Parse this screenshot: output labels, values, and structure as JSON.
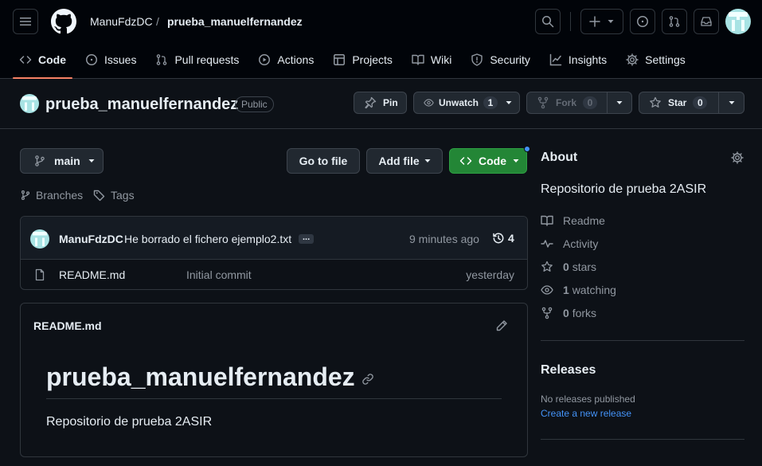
{
  "header": {
    "owner": "ManuFdzDC",
    "separator": "/",
    "repo": "prueba_manuelfernandez"
  },
  "tabs": [
    {
      "label": "Code",
      "icon": "code-icon"
    },
    {
      "label": "Issues",
      "icon": "issue-opened-icon"
    },
    {
      "label": "Pull requests",
      "icon": "git-pull-request-icon"
    },
    {
      "label": "Actions",
      "icon": "play-icon"
    },
    {
      "label": "Projects",
      "icon": "table-icon"
    },
    {
      "label": "Wiki",
      "icon": "book-icon"
    },
    {
      "label": "Security",
      "icon": "shield-icon"
    },
    {
      "label": "Insights",
      "icon": "graph-icon"
    },
    {
      "label": "Settings",
      "icon": "gear-icon"
    }
  ],
  "repo_bar": {
    "name": "prueba_manuelfernandez",
    "visibility": "Public",
    "pin_label": "Pin",
    "watch_label": "Unwatch",
    "watch_count": "1",
    "fork_label": "Fork",
    "fork_count": "0",
    "star_label": "Star",
    "star_count": "0"
  },
  "file_nav": {
    "branch": "main",
    "go_to_file": "Go to file",
    "add_file": "Add file",
    "code": "Code",
    "branches": "Branches",
    "tags": "Tags"
  },
  "commit": {
    "author": "ManuFdzDC",
    "message": "He borrado el fichero ejemplo2.txt",
    "ellipsis": "...",
    "time": "9 minutes ago",
    "count": "4"
  },
  "files": [
    {
      "name": "README.md",
      "message": "Initial commit",
      "time": "yesterday"
    }
  ],
  "readme": {
    "filename": "README.md",
    "heading": "prueba_manuelfernandez",
    "body": "Repositorio de prueba 2ASIR"
  },
  "about": {
    "title": "About",
    "description": "Repositorio de prueba 2ASIR",
    "readme": "Readme",
    "activity": "Activity",
    "stars_num": "0",
    "stars_label": "stars",
    "watching_num": "1",
    "watching_label": "watching",
    "forks_num": "0",
    "forks_label": "forks"
  },
  "releases": {
    "title": "Releases",
    "none": "No releases published",
    "create": "Create a new release"
  },
  "colors": {
    "background": "#0d1117",
    "header": "#010409",
    "accent_green": "#238636",
    "link": "#4493f8",
    "tab_underline": "#f78166"
  }
}
